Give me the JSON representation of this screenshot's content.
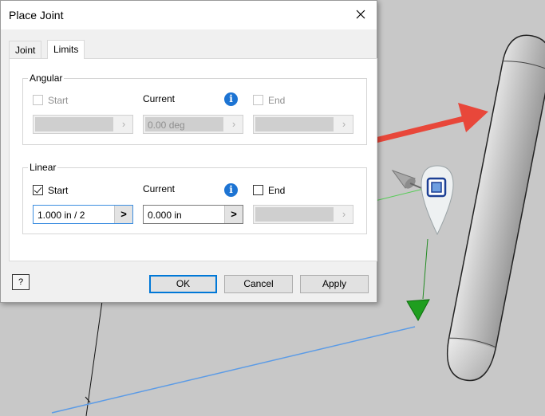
{
  "dialog": {
    "title": "Place Joint",
    "tabs": [
      {
        "label": "Joint",
        "active": false
      },
      {
        "label": "Limits",
        "active": true
      }
    ]
  },
  "angular": {
    "legend": "Angular",
    "start_label": "Start",
    "current_label": "Current",
    "end_label": "End",
    "current_value": "0.00 deg"
  },
  "linear": {
    "legend": "Linear",
    "start_label": "Start",
    "current_label": "Current",
    "end_label": "End",
    "start_value": "1.000 in / 2",
    "current_value": "0.000 in",
    "start_checked": true,
    "end_checked": false
  },
  "glyphs": {
    "arrow": "›",
    "arrow_enabled": ">",
    "info": "i",
    "help": "?"
  },
  "buttons": {
    "ok": "OK",
    "cancel": "Cancel",
    "apply": "Apply"
  },
  "colors": {
    "accent": "#0078d7",
    "info": "#1d74d3",
    "annotation_arrow": "#e8473a",
    "ground_line": "#5b9be6",
    "joint_green": "#22aa22"
  },
  "icons": {
    "close": "close-icon",
    "info": "info-icon",
    "help": "help-icon",
    "joint_glyph": "joint-glyph-icon"
  }
}
